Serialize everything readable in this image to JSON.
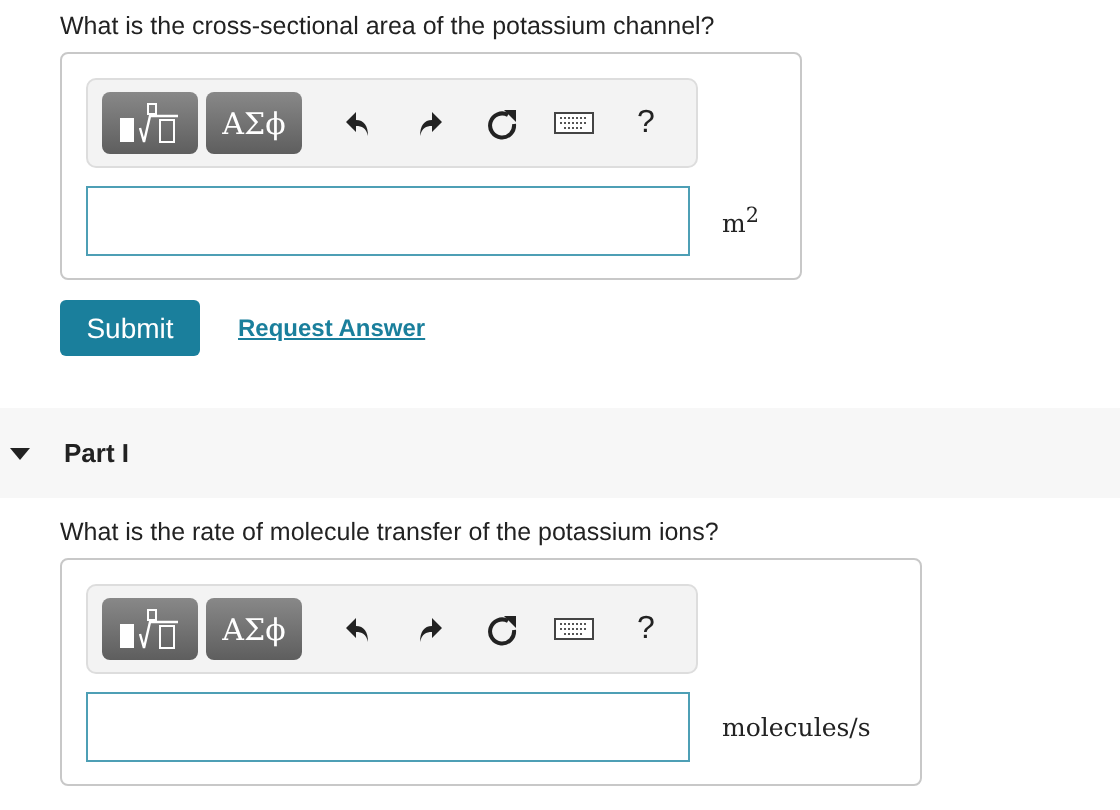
{
  "parts": [
    {
      "question": "What is the cross-sectional area of the potassium channel?",
      "toolbar": [
        {
          "kind": "templates"
        },
        {
          "kind": "greek",
          "label": "ΑΣϕ"
        },
        {
          "kind": "undo"
        },
        {
          "kind": "redo"
        },
        {
          "kind": "reset"
        },
        {
          "kind": "keyboard"
        },
        {
          "kind": "help",
          "label": "?"
        }
      ],
      "unit": "m$^{2}$",
      "actions": {
        "submit": "Submit",
        "request": "Request Answer"
      }
    },
    {
      "header": {
        "title": "Part I",
        "expanded": true
      },
      "question": "What is the rate of molecule transfer of the potassium ions?",
      "toolbar": [
        {
          "kind": "templates"
        },
        {
          "kind": "greek",
          "label": "ΑΣϕ"
        },
        {
          "kind": "undo"
        },
        {
          "kind": "redo"
        },
        {
          "kind": "reset"
        },
        {
          "kind": "keyboard"
        },
        {
          "kind": "help",
          "label": "?"
        }
      ],
      "unit": "molecules/s"
    }
  ]
}
